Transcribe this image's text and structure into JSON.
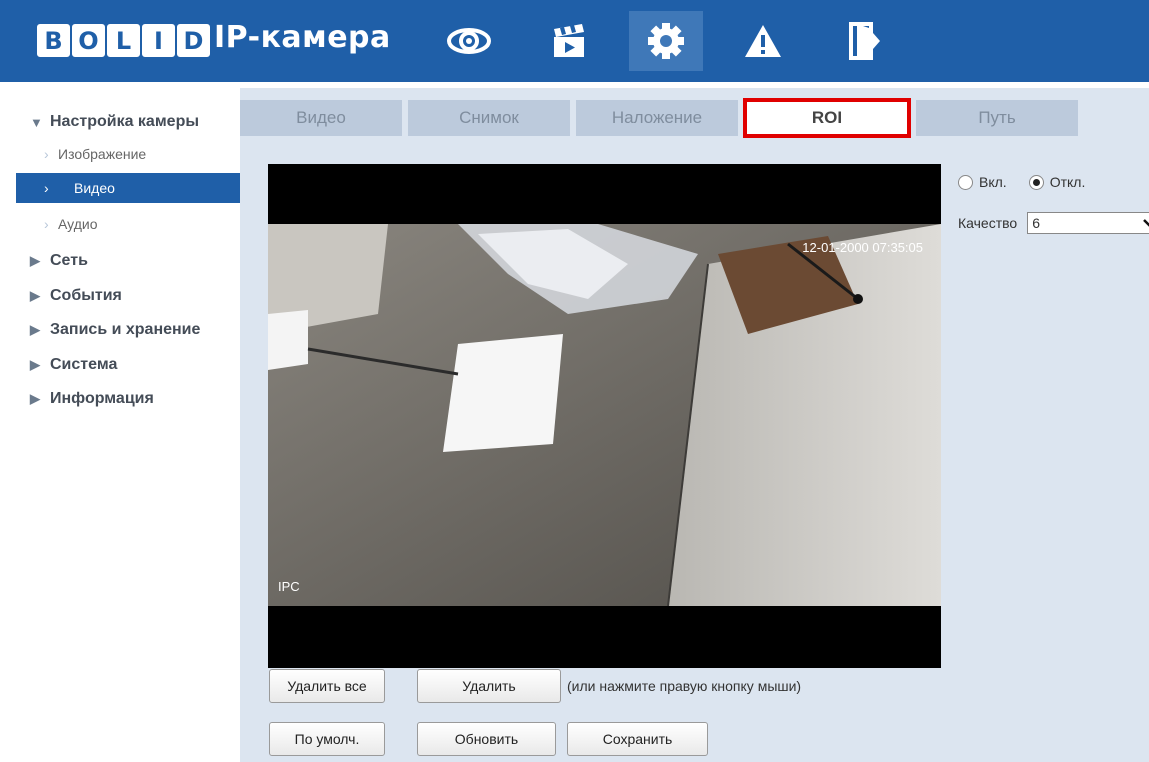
{
  "header": {
    "logo_letters": [
      "B",
      "O",
      "L",
      "I",
      "D"
    ],
    "app_title": "IP-камера",
    "nav": [
      {
        "icon": "eye-icon",
        "label": "Просмотр"
      },
      {
        "icon": "clapperboard-icon",
        "label": "Воспроизведение"
      },
      {
        "icon": "gear-icon",
        "label": "Настройка"
      },
      {
        "icon": "warning-icon",
        "label": "Тревога"
      },
      {
        "icon": "logout-icon",
        "label": "Выход"
      }
    ],
    "active_nav": "gear-icon"
  },
  "sidebar": {
    "items": [
      {
        "label": "Настройка камеры",
        "type": "top",
        "expanded": true
      },
      {
        "label": "Изображение",
        "type": "sub"
      },
      {
        "label": "Видео",
        "type": "sub",
        "active": true
      },
      {
        "label": "Аудио",
        "type": "sub"
      },
      {
        "label": "Сеть",
        "type": "top"
      },
      {
        "label": "События",
        "type": "top"
      },
      {
        "label": "Запись и хранение",
        "type": "top"
      },
      {
        "label": "Система",
        "type": "top"
      },
      {
        "label": "Информация",
        "type": "top"
      }
    ]
  },
  "tabs": [
    {
      "label": "Видео"
    },
    {
      "label": "Снимок"
    },
    {
      "label": "Наложение"
    },
    {
      "label": "ROI",
      "active": true
    },
    {
      "label": "Путь"
    }
  ],
  "video": {
    "osd_time": "12-01-2000 07:35:05",
    "osd_name": "IPC"
  },
  "roi": {
    "on_label": "Вкл.",
    "off_label": "Откл.",
    "selected": "off",
    "quality_label": "Качество",
    "quality_value": "6"
  },
  "buttons": {
    "delete_all": "Удалить все",
    "delete": "Удалить",
    "hint": "(или нажмите правую кнопку мыши)",
    "default": "По умолч.",
    "refresh": "Обновить",
    "save": "Сохранить"
  },
  "colors": {
    "header_bg": "#1f5fa8",
    "main_bg": "#dce5f0",
    "tab_bg": "#bccadc",
    "highlight": "#e00000"
  }
}
